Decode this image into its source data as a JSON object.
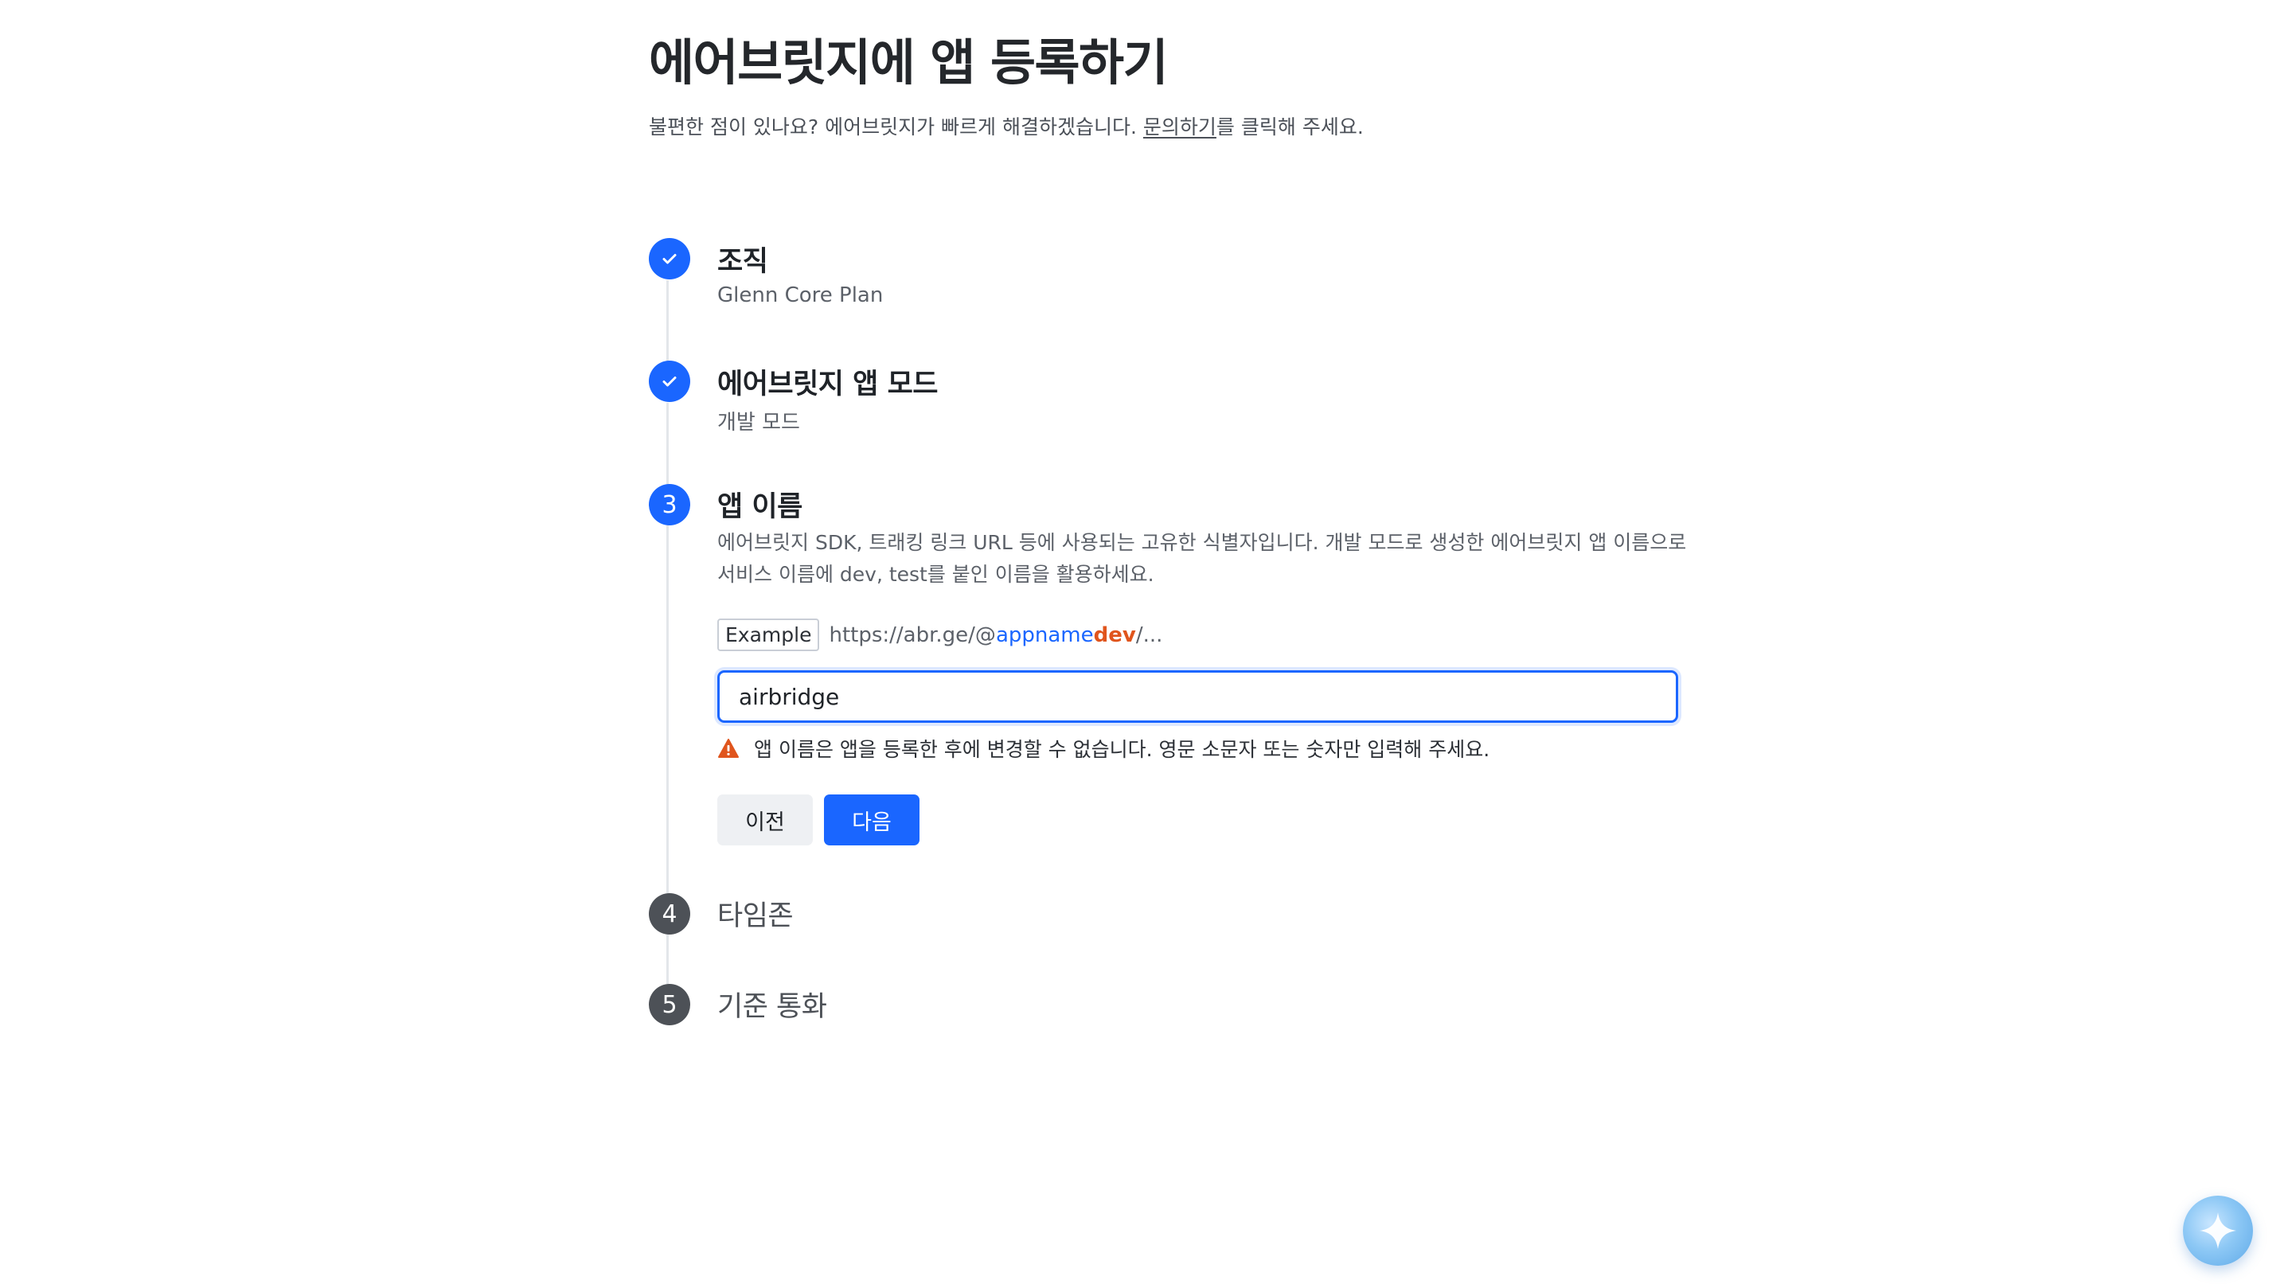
{
  "header": {
    "title": "에어브릿지에 앱 등록하기",
    "subtitle_before": "불편한 점이 있나요? 에어브릿지가 빠르게 해결하겠습니다. ",
    "subtitle_link": "문의하기",
    "subtitle_after": "를 클릭해 주세요."
  },
  "steps": [
    {
      "number": "1",
      "title": "조직",
      "value": "Glenn Core Plan",
      "status": "done"
    },
    {
      "number": "2",
      "title": "에어브릿지 앱 모드",
      "value": "개발 모드",
      "status": "done"
    },
    {
      "number": "3",
      "title": "앱 이름",
      "status": "active"
    },
    {
      "number": "4",
      "title": "타임존",
      "status": "pending"
    },
    {
      "number": "5",
      "title": "기준 통화",
      "status": "pending"
    }
  ],
  "app_name_step": {
    "description": "에어브릿지 SDK, 트래킹 링크 URL 등에 사용되는 고유한 식별자입니다. 개발 모드로 생성한 에어브릿지 앱 이름으로 서비스 이름에 dev, test를 붙인 이름을 활용하세요.",
    "example_label": "Example",
    "example_prefix": "https://abr.ge/@",
    "example_name": "appname",
    "example_suffix": "dev",
    "example_rest": "/...",
    "input_value": "airbridge",
    "warning": "앱 이름은 앱을 등록한 후에 변경할 수 없습니다. 영문 소문자 또는 숫자만 입력해 주세요.",
    "prev_label": "이전",
    "next_label": "다음"
  },
  "colors": {
    "accent": "#1a66ff",
    "pending": "#4d5157",
    "warning": "#e0551d"
  },
  "icons": {
    "done": "check-icon",
    "warning": "warning-triangle-icon",
    "fab": "sparkle-icon"
  }
}
